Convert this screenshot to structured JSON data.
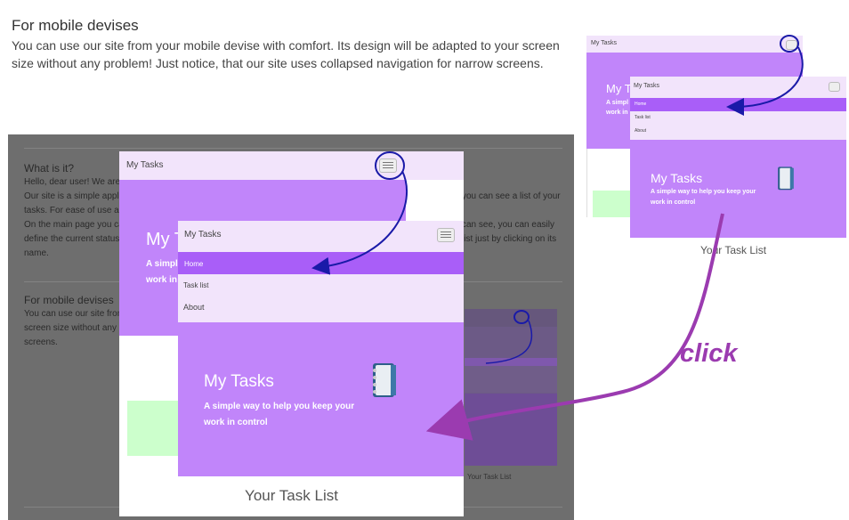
{
  "section": {
    "title": "For mobile devises",
    "text": "You can use our site from your mobile devise with comfort. Its design will be adapted to your screen size without any problem! Just notice, that our site uses collapsed navigation for narrow screens."
  },
  "bg_page": {
    "what_title": "What is it?",
    "what_lines": [
      "Hello, dear user! We are h",
      "Our site is a simple applica",
      "tasks. For ease of use all",
      "On the main page you can",
      "define the current status o",
      "name."
    ],
    "what_right_lines": [
      "you can see a list of your",
      "can see, you can easily",
      "list just by clicking on its"
    ],
    "mobile_title": "For mobile devises",
    "mobile_lines": [
      "You can use our site from",
      "screen size without any p",
      "screens."
    ]
  },
  "phone": {
    "brand": "My Tasks",
    "nav": [
      "Home",
      "Task list",
      "About"
    ],
    "hero_title": "My Tasks",
    "hero_short": "My T",
    "hero_sub_1": "A simple way to help you keep your",
    "hero_sub_2": "work in control",
    "hero_sub_short_1": "A simpl",
    "hero_sub_short_2": "work in",
    "list_title": "Your Task List"
  },
  "annotation": {
    "click": "click"
  },
  "colors": {
    "nav_bg": "#f2e4fb",
    "hero": "#c185fa",
    "active": "#a95ef8",
    "green": "#ccffcc",
    "arrow": "#9b3bb0",
    "blue_mark": "#1a1aa8"
  }
}
